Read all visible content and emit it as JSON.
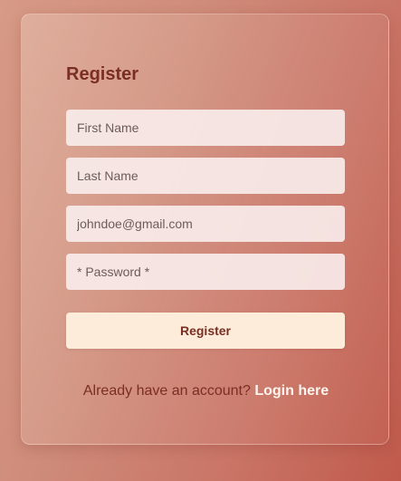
{
  "form": {
    "title": "Register",
    "first_name": {
      "placeholder": "First Name",
      "value": ""
    },
    "last_name": {
      "placeholder": "Last Name",
      "value": ""
    },
    "email": {
      "placeholder": "johndoe@gmail.com",
      "value": ""
    },
    "password": {
      "placeholder": "* Password *",
      "value": ""
    },
    "submit_label": "Register"
  },
  "footer": {
    "prompt": "Already have an account?",
    "login_link": "Login here"
  },
  "colors": {
    "accent": "#7a2e24",
    "button_bg": "#fdecd9",
    "link": "#fff5ee"
  }
}
